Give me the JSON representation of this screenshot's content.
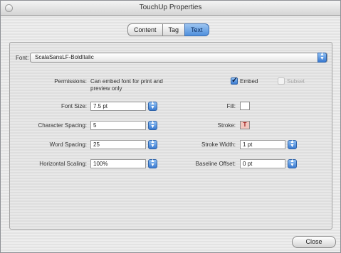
{
  "window": {
    "title": "TouchUp Properties"
  },
  "tabs": [
    {
      "label": "Content"
    },
    {
      "label": "Tag"
    },
    {
      "label": "Text"
    }
  ],
  "font": {
    "label": "Font:",
    "value": "ScalaSansLF-BoldItalic"
  },
  "permissions": {
    "label": "Permissions:",
    "value_line1": "Can embed font for print and",
    "value_line2": "preview only",
    "embed": {
      "label": "Embed",
      "checked": true
    },
    "subset": {
      "label": "Subset",
      "checked": false,
      "enabled": false
    }
  },
  "left_fields": [
    {
      "label": "Font Size:",
      "value": "7.5 pt"
    },
    {
      "label": "Character Spacing:",
      "value": "5"
    },
    {
      "label": "Word Spacing:",
      "value": "25"
    },
    {
      "label": "Horizontal Scaling:",
      "value": "100%"
    }
  ],
  "fill": {
    "label": "Fill:"
  },
  "stroke": {
    "label": "Stroke:",
    "swatch_text": "T"
  },
  "stroke_width": {
    "label": "Stroke Width:",
    "value": "1 pt"
  },
  "baseline_offset": {
    "label": "Baseline Offset:",
    "value": "0 pt"
  },
  "close_button": {
    "label": "Close"
  },
  "colors": {
    "accent": "#4f8fdc",
    "stroke_swatch": "#f2c7bf"
  }
}
